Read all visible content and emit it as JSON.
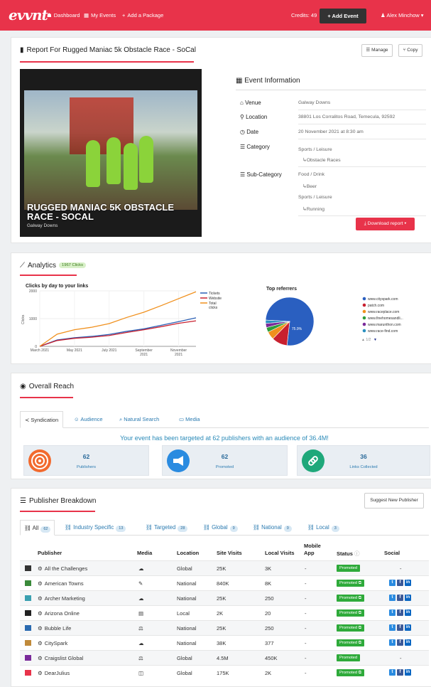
{
  "nav": {
    "logo": "evvnt",
    "links": [
      {
        "icon": "dashboard-icon",
        "glyph": "☗",
        "label": "Dashboard"
      },
      {
        "icon": "calendar-icon",
        "glyph": "▦",
        "label": "My Events"
      },
      {
        "icon": "plus-icon",
        "glyph": "+",
        "label": "Add a Package"
      }
    ],
    "credits": "Credits: 49",
    "add_event": "+ Add Event",
    "user": "Alex Minchow"
  },
  "report": {
    "title": "Report For Rugged Maniac 5k Obstacle Race - SoCal",
    "manage": "Manage",
    "copy": "Copy",
    "photo_caption": "RUGGED MANIAC 5K OBSTACLE RACE - SOCAL",
    "photo_sub": "Galway Downs",
    "info_title": "Event Information",
    "venue_label": "Venue",
    "venue": "Galway Downs",
    "location_label": "Location",
    "location": "38801 Los Corralitos Road, Temecula, 92592",
    "date_label": "Date",
    "date": "20 November 2021 at 8:30 am",
    "category_label": "Category",
    "category": "Sports / Leisure",
    "category_sub": "↳Obstacle Races",
    "subcategory_label": "Sub-Category",
    "sub1": "Food / Drink",
    "sub1_child": "↳Beer",
    "sub2": "Sports / Leisure",
    "sub2_child": "↳Running",
    "download": "Download report"
  },
  "analytics": {
    "title": "Analytics",
    "clicks_badge": "1967 Clicks",
    "line_title": "Clicks by day to your links",
    "pie_title": "Top referrers",
    "pie_pager": "1/2",
    "help_glyph": "?"
  },
  "chart_data": [
    {
      "type": "line",
      "title": "Clicks by day to your links",
      "ylabel": "Clicks",
      "ylim": [
        0,
        2000
      ],
      "yticks": [
        "0",
        "1000",
        "2000"
      ],
      "xticks": [
        "March 2021",
        "May 2021",
        "July 2021",
        "September 2021",
        "November 2021"
      ],
      "x": [
        "Mar 2021",
        "Apr 2021",
        "May 2021",
        "Jun 2021",
        "Jul 2021",
        "Aug 2021",
        "Sep 2021",
        "Oct 2021",
        "Nov 2021",
        "Dec 2021"
      ],
      "series": [
        {
          "name": "Tickets",
          "color": "#2a5fb5",
          "values": [
            0,
            230,
            310,
            360,
            430,
            540,
            630,
            760,
            890,
            1030
          ]
        },
        {
          "name": "Website",
          "color": "#c8202f",
          "values": [
            0,
            210,
            290,
            330,
            390,
            500,
            600,
            710,
            830,
            920
          ]
        },
        {
          "name": "Total clicks",
          "color": "#f0901d",
          "values": [
            0,
            440,
            600,
            690,
            820,
            1040,
            1230,
            1470,
            1720,
            1967
          ]
        }
      ]
    },
    {
      "type": "pie",
      "title": "Top referrers",
      "series": [
        {
          "name": "www.cityspark.com",
          "value": 75.9,
          "color": "#2a5fc0"
        },
        {
          "name": "patch.com",
          "value": 10.5,
          "color": "#c8202f"
        },
        {
          "name": "www.raceplace.com",
          "value": 5.4,
          "color": "#f0901d"
        },
        {
          "name": "www.finehomesandli...",
          "value": 3.2,
          "color": "#2e9e3a"
        },
        {
          "name": "www.marunthon.com",
          "value": 2.8,
          "color": "#7a2a9a"
        },
        {
          "name": "www.race-find.com",
          "value": 2.2,
          "color": "#2a90c0"
        }
      ],
      "center_label": "75.9%"
    }
  ],
  "reach": {
    "title": "Overall Reach",
    "tabs": [
      "Syndication",
      "Audience",
      "Natural Search",
      "Media"
    ],
    "message": "Your event has been targeted at 62 publishers with an audience of 36.4M!",
    "cards": [
      {
        "num": "62",
        "label": "Publishers",
        "color": "#f26a2e"
      },
      {
        "num": "62",
        "label": "Promoted",
        "color": "#2a8be0"
      },
      {
        "num": "36",
        "label": "Links Collected",
        "color": "#1fa87a"
      }
    ]
  },
  "breakdown": {
    "title": "Publisher Breakdown",
    "suggest": "Suggest New Publisher",
    "filters": [
      {
        "label": "All",
        "count": "62"
      },
      {
        "label": "Industry Specific",
        "count": "13"
      },
      {
        "label": "Targeted",
        "count": "28"
      },
      {
        "label": "Global",
        "count": "9"
      },
      {
        "label": "National",
        "count": "9"
      },
      {
        "label": "Local",
        "count": "3"
      }
    ],
    "headers": {
      "publisher": "Publisher",
      "media": "Media",
      "location": "Location",
      "site_visits": "Site Visits",
      "local_visits": "Local Visits",
      "mobile_app": "Mobile App",
      "status": "Status",
      "social": "Social"
    },
    "rows": [
      {
        "name": "All the Challenges",
        "media": "☁",
        "location": "Global",
        "site": "25K",
        "local": "3K",
        "app": "-",
        "status": "Promoted",
        "ext": false,
        "social": false,
        "logo": "#333"
      },
      {
        "name": "American Towns",
        "media": "✎",
        "location": "National",
        "site": "840K",
        "local": "8K",
        "app": "-",
        "status": "Promoted",
        "ext": true,
        "social": true,
        "logo": "#3a8a3a"
      },
      {
        "name": "Archer Marketing",
        "media": "☁",
        "location": "National",
        "site": "25K",
        "local": "250",
        "app": "-",
        "status": "Promoted",
        "ext": true,
        "social": true,
        "logo": "#3aa0b0"
      },
      {
        "name": "Arizona Online",
        "media": "▤",
        "location": "Local",
        "site": "2K",
        "local": "20",
        "app": "-",
        "status": "Promoted",
        "ext": true,
        "social": true,
        "logo": "#222"
      },
      {
        "name": "Bubble Life",
        "media": "⚖",
        "location": "National",
        "site": "25K",
        "local": "250",
        "app": "-",
        "status": "Promoted",
        "ext": true,
        "social": true,
        "logo": "#2a6ab0"
      },
      {
        "name": "CitySpark",
        "media": "☁",
        "location": "National",
        "site": "38K",
        "local": "377",
        "app": "-",
        "status": "Promoted",
        "ext": true,
        "social": true,
        "logo": "#c08a3a"
      },
      {
        "name": "Craigslist Global",
        "media": "⚖",
        "location": "Global",
        "site": "4.5M",
        "local": "450K",
        "app": "-",
        "status": "Promoted",
        "ext": false,
        "social": false,
        "logo": "#7a2a9a"
      },
      {
        "name": "DearJulius",
        "media": "◫",
        "location": "Global",
        "site": "175K",
        "local": "2K",
        "app": "-",
        "status": "Promoted",
        "ext": true,
        "social": true,
        "logo": "#e8334a"
      }
    ],
    "dash": "-"
  }
}
